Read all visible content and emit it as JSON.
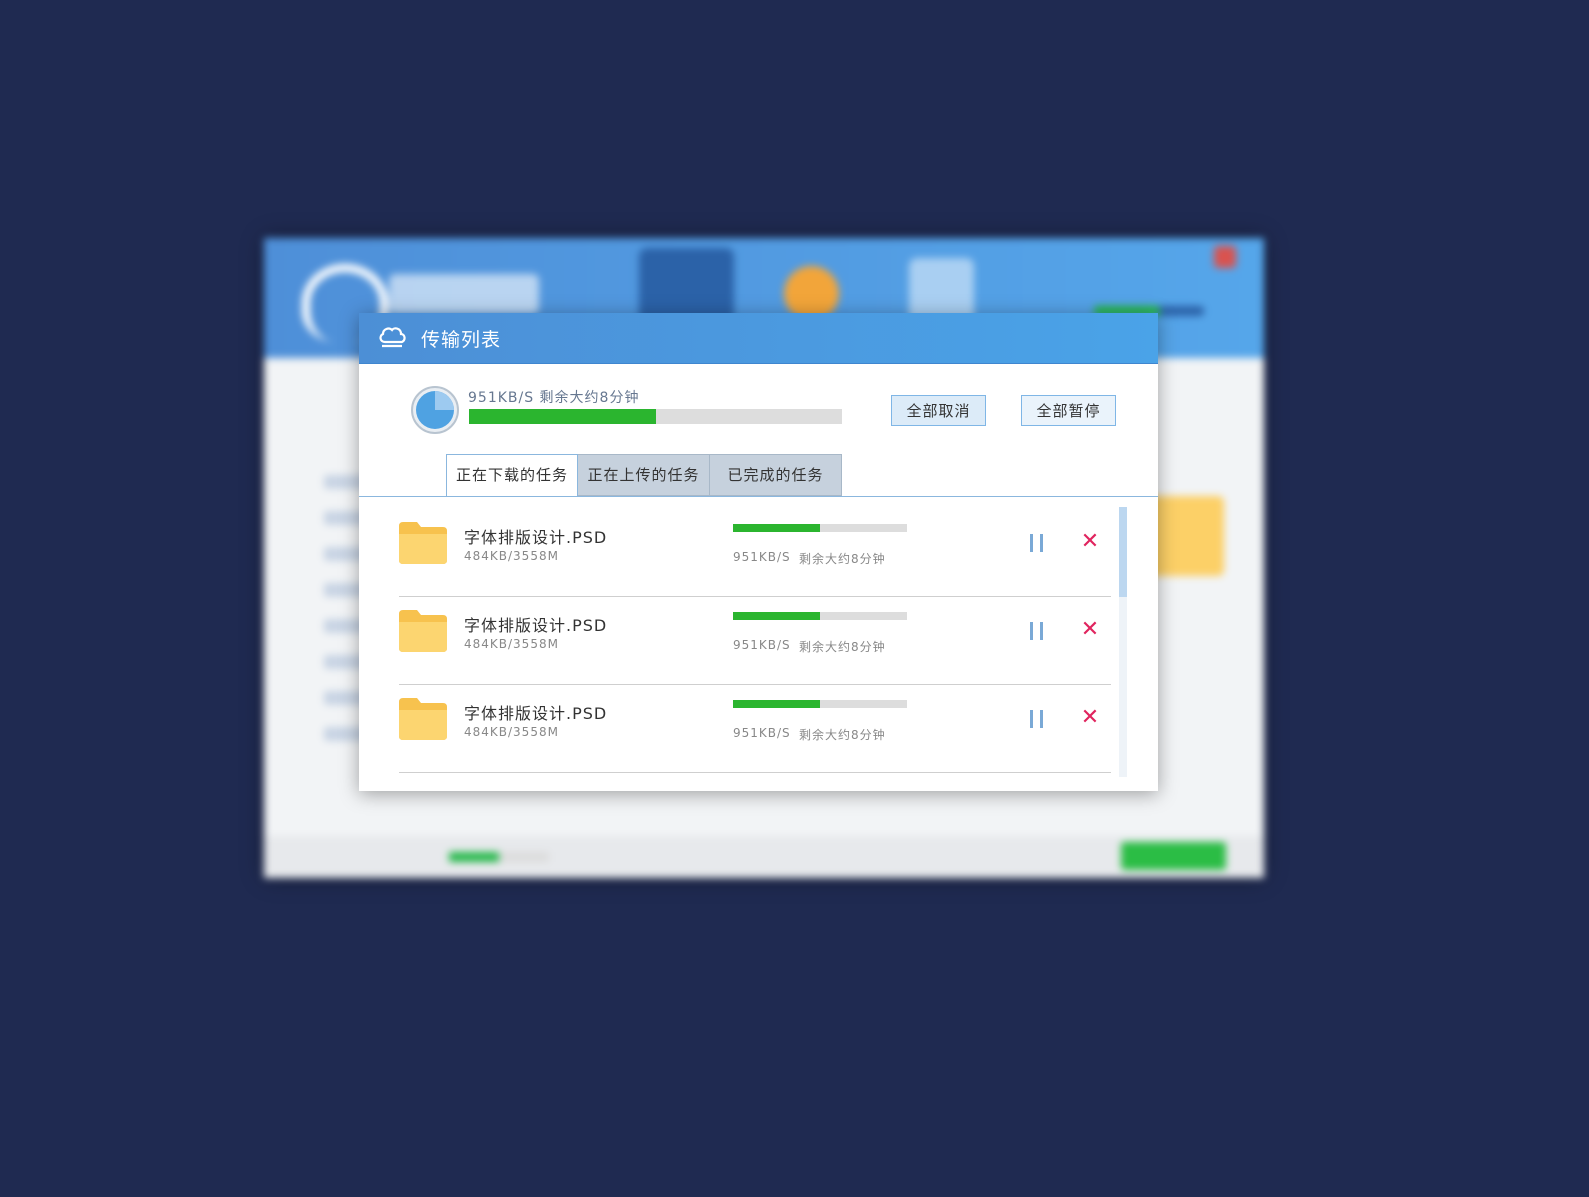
{
  "colors": {
    "background": "#1f2a51",
    "titlebar": "#4c8fd6",
    "progress_fill": "#2bb52f",
    "cancel_icon": "#e0245e",
    "pause_icon": "#7aa9d6"
  },
  "dialog": {
    "title": "传输列表",
    "summary": {
      "text": "951KB/S 剩余大约8分钟",
      "progress": 0.5
    },
    "buttons": {
      "cancel_all": "全部取消",
      "pause_all": "全部暂停"
    },
    "tabs": [
      {
        "label": "正在下载的任务",
        "active": true
      },
      {
        "label": "正在上传的任务",
        "active": false
      },
      {
        "label": "已完成的任务",
        "active": false
      }
    ],
    "tasks": [
      {
        "name": "字体排版设计.PSD",
        "size": "484KB/3558M",
        "speed": "951KB/S",
        "remaining": "剩余大约8分钟",
        "progress": 0.5
      },
      {
        "name": "字体排版设计.PSD",
        "size": "484KB/3558M",
        "speed": "951KB/S",
        "remaining": "剩余大约8分钟",
        "progress": 0.5
      },
      {
        "name": "字体排版设计.PSD",
        "size": "484KB/3558M",
        "speed": "951KB/S",
        "remaining": "剩余大约8分钟",
        "progress": 0.5
      }
    ],
    "icons": {
      "title_icon": "cloud-icon",
      "summary_icon": "pie-progress-icon",
      "file_icon": "folder-icon",
      "pause_icon": "pause-icon",
      "cancel_icon": "close-icon"
    }
  }
}
